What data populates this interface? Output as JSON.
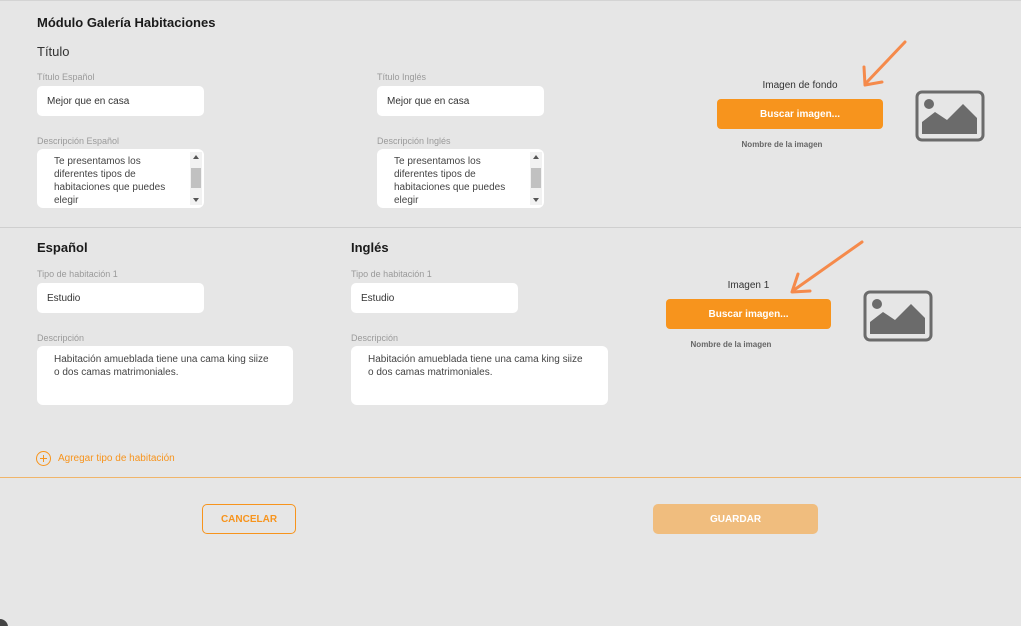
{
  "module": {
    "title": "Módulo Galería Habitaciones",
    "section_title": "Título"
  },
  "titles": {
    "es_label": "Título Español",
    "es_value": "Mejor que en casa",
    "en_label": "Título Inglés",
    "en_value": "Mejor que en casa",
    "desc_es_label": "Descripción Español",
    "desc_es_value": "Te presentamos los diferentes tipos de habitaciones que puedes elegir",
    "desc_en_label": "Descripción Inglés",
    "desc_en_value": "Te presentamos los diferentes tipos de habitaciones que puedes elegir"
  },
  "background_image": {
    "caption": "Imagen de fondo",
    "button": "Buscar imagen...",
    "name_label": "Nombre de la imagen",
    "icon": "image-placeholder-icon"
  },
  "rooms": {
    "es_heading": "Español",
    "en_heading": "Inglés",
    "es_type_label": "Tipo de habitación 1",
    "es_type_value": "Estudio",
    "en_type_label": "Tipo de habitación 1",
    "en_type_value": "Estudio",
    "es_desc_label": "Descripción",
    "es_desc_value": "Habitación amueblada tiene una cama king siize o dos camas matrimoniales.",
    "en_desc_label": "Descripción",
    "en_desc_value": "Habitación amueblada tiene una cama king siize o dos camas matrimoniales.",
    "image_caption": "Imagen 1",
    "image_button": "Buscar imagen...",
    "image_name_label": "Nombre de la imagen",
    "add_room": "Agregar tipo de habitación"
  },
  "actions": {
    "cancel": "CANCELAR",
    "save": "GUARDAR"
  },
  "colors": {
    "accent": "#f7941d",
    "accent_disabled": "#f0bd7e",
    "arrow": "#f58a4b",
    "background": "#e6e6e6"
  }
}
